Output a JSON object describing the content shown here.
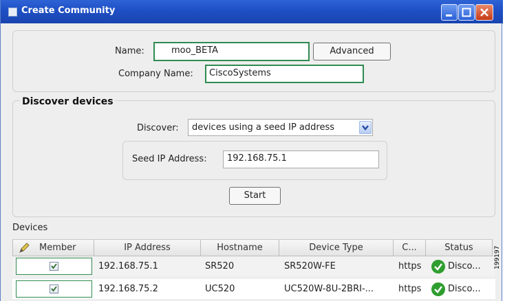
{
  "window": {
    "title": "Create Community",
    "buttons": {
      "minimize": "minimize-icon",
      "maximize": "maximize-icon",
      "close": "close-icon"
    }
  },
  "community": {
    "name_label": "Name:",
    "name_value": "moo_BETA",
    "advanced_label": "Advanced",
    "company_label": "Company Name:",
    "company_value": "CiscoSystems"
  },
  "discover": {
    "section_title": "Discover devices",
    "discover_label": "Discover:",
    "discover_value": "devices using a seed IP address",
    "seed_label": "Seed IP Address:",
    "seed_value": "192.168.75.1",
    "start_label": "Start"
  },
  "devices": {
    "section_label": "Devices",
    "columns": [
      "Member",
      "IP Address",
      "Hostname",
      "Device Type",
      "C...",
      "Status"
    ],
    "rows": [
      {
        "member": true,
        "ip": "192.168.75.1",
        "hostname": "SR520",
        "device_type": "SR520W-FE",
        "conn": "https",
        "status": "Disco..."
      },
      {
        "member": true,
        "ip": "192.168.75.2",
        "hostname": "UC520",
        "device_type": "UC520W-8U-2BRI-...",
        "conn": "https",
        "status": "Disco..."
      }
    ]
  },
  "figure_id": "199197",
  "colors": {
    "titlebar": "#1e4fc4",
    "member_border": "#2e8b4f",
    "status_ok": "#2f9e2f",
    "row_alt": "#f2f2f2"
  }
}
